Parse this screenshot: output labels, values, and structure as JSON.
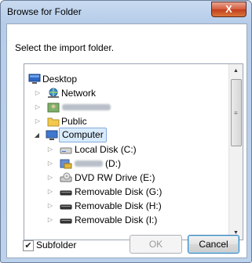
{
  "window": {
    "title": "Browse for Folder",
    "close_label": "X"
  },
  "prompt": "Select the import folder.",
  "tree": [
    {
      "label": "Desktop",
      "icon": "desktop-icon",
      "expander": ""
    },
    {
      "label": "Network",
      "icon": "network-icon",
      "expander": "▷"
    },
    {
      "label": "",
      "icon": "user-folder-icon",
      "expander": "▷",
      "blurred": true
    },
    {
      "label": "Public",
      "icon": "folder-icon",
      "expander": "▷"
    },
    {
      "label": "Computer",
      "icon": "computer-icon",
      "expander": "◢",
      "selected": true
    },
    {
      "label": "Local Disk (C:)",
      "icon": "hard-disk-icon",
      "expander": "▷"
    },
    {
      "label": "(D:)",
      "icon": "drive-icon",
      "expander": "▷",
      "blurred": true
    },
    {
      "label": "DVD RW Drive (E:)",
      "icon": "dvd-drive-icon",
      "expander": "▷"
    },
    {
      "label": "Removable Disk (G:)",
      "icon": "removable-disk-icon",
      "expander": "▷"
    },
    {
      "label": "Removable Disk (H:)",
      "icon": "removable-disk-icon",
      "expander": "▷"
    },
    {
      "label": "Removable Disk (I:)",
      "icon": "removable-disk-icon",
      "expander": "▷"
    }
  ],
  "scrollbar": {
    "up": "▲",
    "down": "▼",
    "grip": "≡"
  },
  "subfolder": {
    "label": "Subfolder",
    "checked": true,
    "mark": "✔"
  },
  "buttons": {
    "ok": "OK",
    "cancel": "Cancel"
  },
  "colors": {
    "selection": "#d9ebfb",
    "close_button": "#c8482a",
    "title_gradient": "#b6cde9"
  }
}
